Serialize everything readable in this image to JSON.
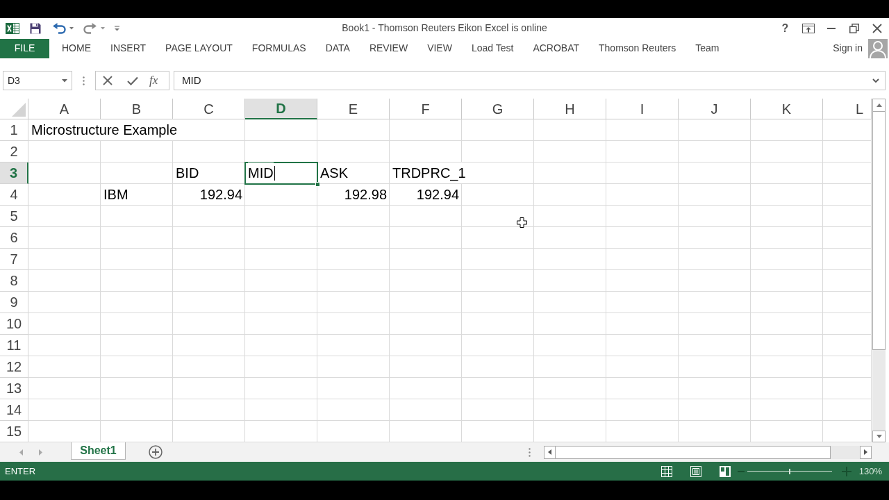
{
  "title_bar": {
    "title": "Book1 - Thomson Reuters Eikon Excel is online",
    "help": "?"
  },
  "ribbon": {
    "tabs": [
      {
        "label": "FILE",
        "kind": "file"
      },
      {
        "label": "HOME",
        "kind": "tab"
      },
      {
        "label": "INSERT",
        "kind": "tab"
      },
      {
        "label": "PAGE LAYOUT",
        "kind": "tab"
      },
      {
        "label": "FORMULAS",
        "kind": "tab"
      },
      {
        "label": "DATA",
        "kind": "tab"
      },
      {
        "label": "REVIEW",
        "kind": "tab"
      },
      {
        "label": "VIEW",
        "kind": "tab"
      },
      {
        "label": "Load Test",
        "kind": "tab"
      },
      {
        "label": "ACROBAT",
        "kind": "tab"
      },
      {
        "label": "Thomson Reuters",
        "kind": "tab"
      },
      {
        "label": "Team",
        "kind": "tab"
      }
    ],
    "account": {
      "label": "Sign in"
    }
  },
  "formula_bar": {
    "name_box": "D3",
    "function_label": "fx",
    "value": "MID"
  },
  "sheet": {
    "editing": true,
    "columns": [
      {
        "label": "A",
        "selected": false
      },
      {
        "label": "B",
        "selected": false
      },
      {
        "label": "C",
        "selected": false
      },
      {
        "label": "D",
        "selected": true
      },
      {
        "label": "E",
        "selected": false
      },
      {
        "label": "F",
        "selected": false
      },
      {
        "label": "G",
        "selected": false
      },
      {
        "label": "H",
        "selected": false
      },
      {
        "label": "I",
        "selected": false
      },
      {
        "label": "J",
        "selected": false
      },
      {
        "label": "K",
        "selected": false
      },
      {
        "label": "L",
        "selected": false
      }
    ],
    "rows": [
      {
        "label": "1",
        "selected": false,
        "cells": [
          {
            "text": "Microstructure Example",
            "kind": "text"
          }
        ]
      },
      {
        "label": "2",
        "selected": false
      },
      {
        "label": "3",
        "selected": true,
        "cells": [
          null,
          null,
          {
            "text": "BID",
            "kind": "text"
          },
          {
            "text": "MID",
            "kind": "text"
          },
          {
            "text": "ASK",
            "kind": "text"
          },
          {
            "text": "TRDPRC_1",
            "kind": "text"
          }
        ]
      },
      {
        "label": "4",
        "selected": false,
        "cells": [
          null,
          {
            "text": "IBM",
            "kind": "text"
          },
          {
            "text": "192.94",
            "kind": "number"
          },
          null,
          {
            "text": "192.98",
            "kind": "number"
          },
          {
            "text": "192.94",
            "kind": "number"
          }
        ]
      },
      {
        "label": "5",
        "selected": false
      },
      {
        "label": "6",
        "selected": false
      },
      {
        "label": "7",
        "selected": false
      },
      {
        "label": "8",
        "selected": false
      },
      {
        "label": "9",
        "selected": false
      },
      {
        "label": "10",
        "selected": false
      },
      {
        "label": "11",
        "selected": false
      },
      {
        "label": "12",
        "selected": false
      },
      {
        "label": "13",
        "selected": false
      },
      {
        "label": "14",
        "selected": false
      },
      {
        "label": "15",
        "selected": false
      }
    ]
  },
  "sheet_tabs": [
    {
      "label": "Sheet1",
      "selected": true
    }
  ],
  "status_bar": {
    "mode": "ENTER",
    "zoom": {
      "level": 0.5,
      "reading": "130%"
    }
  }
}
